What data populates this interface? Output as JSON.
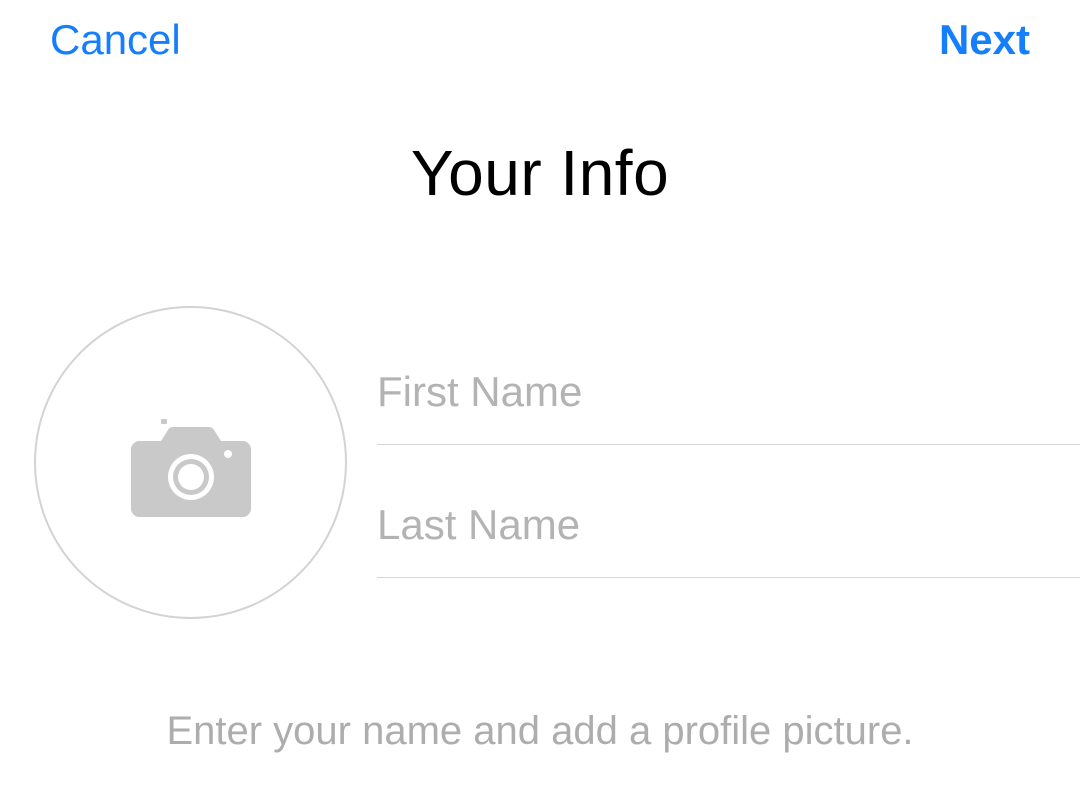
{
  "nav": {
    "cancel_label": "Cancel",
    "next_label": "Next"
  },
  "title": "Your Info",
  "form": {
    "first_name_placeholder": "First Name",
    "first_name_value": "",
    "last_name_placeholder": "Last Name",
    "last_name_value": ""
  },
  "hint": "Enter your name and add a profile picture."
}
